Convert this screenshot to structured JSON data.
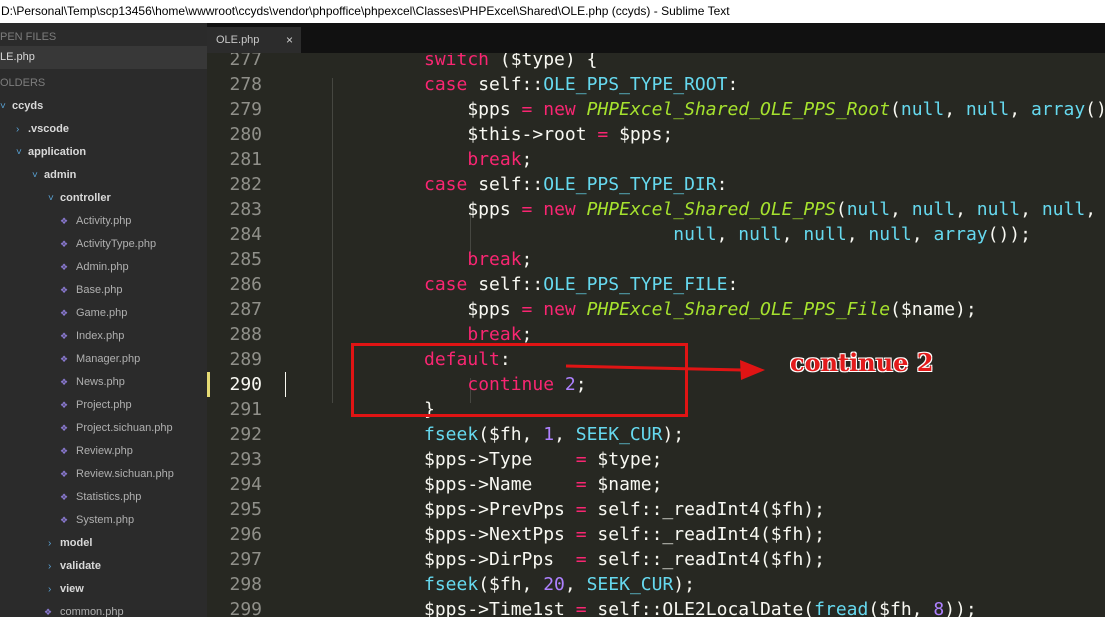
{
  "window": {
    "title": "D:\\Personal\\Temp\\scp13456\\home\\wwwroot\\ccyds\\vendor\\phpoffice\\phpexcel\\Classes\\PHPExcel\\Shared\\OLE.php (ccyds) - Sublime Text"
  },
  "sidebar": {
    "open_files_header": "PEN FILES",
    "open_file": "LE.php",
    "folders_header": "OLDERS",
    "tree": [
      {
        "label": "ccyds",
        "type": "folder",
        "expanded": true
      },
      {
        "label": ".vscode",
        "type": "folder",
        "expanded": false
      },
      {
        "label": "application",
        "type": "folder",
        "expanded": true
      },
      {
        "label": "admin",
        "type": "folder",
        "expanded": true
      },
      {
        "label": "controller",
        "type": "folder",
        "expanded": true
      },
      {
        "label": "Activity.php",
        "type": "file"
      },
      {
        "label": "ActivityType.php",
        "type": "file"
      },
      {
        "label": "Admin.php",
        "type": "file"
      },
      {
        "label": "Base.php",
        "type": "file"
      },
      {
        "label": "Game.php",
        "type": "file"
      },
      {
        "label": "Index.php",
        "type": "file"
      },
      {
        "label": "Manager.php",
        "type": "file"
      },
      {
        "label": "News.php",
        "type": "file"
      },
      {
        "label": "Project.php",
        "type": "file"
      },
      {
        "label": "Project.sichuan.php",
        "type": "file"
      },
      {
        "label": "Review.php",
        "type": "file"
      },
      {
        "label": "Review.sichuan.php",
        "type": "file"
      },
      {
        "label": "Statistics.php",
        "type": "file"
      },
      {
        "label": "System.php",
        "type": "file"
      },
      {
        "label": "model",
        "type": "folder",
        "expanded": false
      },
      {
        "label": "validate",
        "type": "folder",
        "expanded": false
      },
      {
        "label": "view",
        "type": "folder",
        "expanded": false
      },
      {
        "label": "common.php",
        "type": "file"
      }
    ]
  },
  "tabs": [
    {
      "label": "OLE.php",
      "close": "×"
    }
  ],
  "editor": {
    "current_line": "290",
    "lines": [
      {
        "n": "277",
        "tokens": [
          [
            "k",
            "switch"
          ],
          [
            "t",
            " ($type) {"
          ]
        ]
      },
      {
        "n": "278",
        "tokens": [
          [
            "k",
            "case"
          ],
          [
            "t",
            " self::"
          ],
          [
            "b",
            "OLE_PPS_TYPE_ROOT"
          ],
          [
            "t",
            ":"
          ]
        ]
      },
      {
        "n": "279",
        "tokens": [
          [
            "t",
            "    $pps "
          ],
          [
            "k",
            "="
          ],
          [
            "t",
            " "
          ],
          [
            "k",
            "new"
          ],
          [
            "t",
            " "
          ],
          [
            "f",
            "PHPExcel_Shared_OLE_PPS_Root"
          ],
          [
            "t",
            "("
          ],
          [
            "b",
            "null"
          ],
          [
            "t",
            ", "
          ],
          [
            "b",
            "null"
          ],
          [
            "t",
            ", "
          ],
          [
            "b",
            "array"
          ],
          [
            "t",
            "());"
          ]
        ]
      },
      {
        "n": "280",
        "tokens": [
          [
            "t",
            "    $this->root "
          ],
          [
            "k",
            "="
          ],
          [
            "t",
            " $pps;"
          ]
        ]
      },
      {
        "n": "281",
        "tokens": [
          [
            "t",
            "    "
          ],
          [
            "k",
            "break"
          ],
          [
            "t",
            ";"
          ]
        ]
      },
      {
        "n": "282",
        "tokens": [
          [
            "k",
            "case"
          ],
          [
            "t",
            " self::"
          ],
          [
            "b",
            "OLE_PPS_TYPE_DIR"
          ],
          [
            "t",
            ":"
          ]
        ]
      },
      {
        "n": "283",
        "tokens": [
          [
            "t",
            "    $pps "
          ],
          [
            "k",
            "="
          ],
          [
            "t",
            " "
          ],
          [
            "k",
            "new"
          ],
          [
            "t",
            " "
          ],
          [
            "f",
            "PHPExcel_Shared_OLE_PPS"
          ],
          [
            "t",
            "("
          ],
          [
            "b",
            "null"
          ],
          [
            "t",
            ", "
          ],
          [
            "b",
            "null"
          ],
          [
            "t",
            ", "
          ],
          [
            "b",
            "null"
          ],
          [
            "t",
            ", "
          ],
          [
            "b",
            "null"
          ],
          [
            "t",
            ", "
          ],
          [
            "b",
            "null"
          ],
          [
            "t",
            ","
          ]
        ]
      },
      {
        "n": "284",
        "tokens": [
          [
            "t",
            "                       "
          ],
          [
            "b",
            "null"
          ],
          [
            "t",
            ", "
          ],
          [
            "b",
            "null"
          ],
          [
            "t",
            ", "
          ],
          [
            "b",
            "null"
          ],
          [
            "t",
            ", "
          ],
          [
            "b",
            "null"
          ],
          [
            "t",
            ", "
          ],
          [
            "b",
            "array"
          ],
          [
            "t",
            "());"
          ]
        ]
      },
      {
        "n": "285",
        "tokens": [
          [
            "t",
            "    "
          ],
          [
            "k",
            "break"
          ],
          [
            "t",
            ";"
          ]
        ]
      },
      {
        "n": "286",
        "tokens": [
          [
            "k",
            "case"
          ],
          [
            "t",
            " self::"
          ],
          [
            "b",
            "OLE_PPS_TYPE_FILE"
          ],
          [
            "t",
            ":"
          ]
        ]
      },
      {
        "n": "287",
        "tokens": [
          [
            "t",
            "    $pps "
          ],
          [
            "k",
            "="
          ],
          [
            "t",
            " "
          ],
          [
            "k",
            "new"
          ],
          [
            "t",
            " "
          ],
          [
            "f",
            "PHPExcel_Shared_OLE_PPS_File"
          ],
          [
            "t",
            "($name);"
          ]
        ]
      },
      {
        "n": "288",
        "tokens": [
          [
            "t",
            "    "
          ],
          [
            "k",
            "break"
          ],
          [
            "t",
            ";"
          ]
        ]
      },
      {
        "n": "289",
        "tokens": [
          [
            "k",
            "default"
          ],
          [
            "t",
            ":"
          ]
        ]
      },
      {
        "n": "290",
        "tokens": [
          [
            "t",
            "    "
          ],
          [
            "k",
            "continue"
          ],
          [
            "t",
            " "
          ],
          [
            "c",
            "2"
          ],
          [
            "t",
            ";"
          ]
        ]
      },
      {
        "n": "291",
        "tokens": [
          [
            "t",
            "}"
          ]
        ]
      },
      {
        "n": "292",
        "tokens": [
          [
            "b",
            "fseek"
          ],
          [
            "t",
            "($fh, "
          ],
          [
            "c",
            "1"
          ],
          [
            "t",
            ", "
          ],
          [
            "b",
            "SEEK_CUR"
          ],
          [
            "t",
            ");"
          ]
        ]
      },
      {
        "n": "293",
        "tokens": [
          [
            "t",
            "$pps->Type    "
          ],
          [
            "k",
            "="
          ],
          [
            "t",
            " $type;"
          ]
        ]
      },
      {
        "n": "294",
        "tokens": [
          [
            "t",
            "$pps->Name    "
          ],
          [
            "k",
            "="
          ],
          [
            "t",
            " $name;"
          ]
        ]
      },
      {
        "n": "295",
        "tokens": [
          [
            "t",
            "$pps->PrevPps "
          ],
          [
            "k",
            "="
          ],
          [
            "t",
            " self::_readInt4($fh);"
          ]
        ]
      },
      {
        "n": "296",
        "tokens": [
          [
            "t",
            "$pps->NextPps "
          ],
          [
            "k",
            "="
          ],
          [
            "t",
            " self::_readInt4($fh);"
          ]
        ]
      },
      {
        "n": "297",
        "tokens": [
          [
            "t",
            "$pps->DirPps  "
          ],
          [
            "k",
            "="
          ],
          [
            "t",
            " self::_readInt4($fh);"
          ]
        ]
      },
      {
        "n": "298",
        "tokens": [
          [
            "b",
            "fseek"
          ],
          [
            "t",
            "($fh, "
          ],
          [
            "c",
            "20"
          ],
          [
            "t",
            ", "
          ],
          [
            "b",
            "SEEK_CUR"
          ],
          [
            "t",
            ");"
          ]
        ]
      },
      {
        "n": "299",
        "tokens": [
          [
            "t",
            "$pps->Time1st "
          ],
          [
            "k",
            "="
          ],
          [
            "t",
            " self::OLE2LocalDate("
          ],
          [
            "b",
            "fread"
          ],
          [
            "t",
            "($fh, "
          ],
          [
            "c",
            "8"
          ],
          [
            "t",
            "));"
          ]
        ]
      }
    ]
  },
  "annotation": {
    "text": "continue 2",
    "color": "#e01414"
  },
  "colors": {
    "keyword": "#f92672",
    "function": "#a6e22e",
    "number": "#ae81ff",
    "builtin": "#66d9ef",
    "text": "#f8f8f2",
    "background": "#272822"
  }
}
